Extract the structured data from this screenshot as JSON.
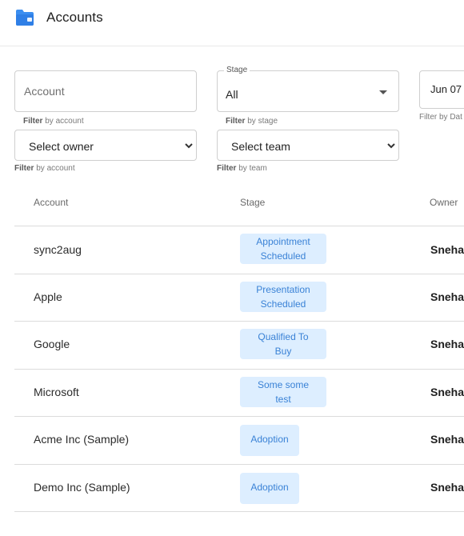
{
  "header": {
    "title": "Accounts",
    "icon": "folder-icon",
    "icon_color": "#3b8ef0"
  },
  "filters": {
    "account": {
      "placeholder": "Account",
      "hint_bold": "Filter",
      "hint_rest": " by account"
    },
    "stage": {
      "legend": "Stage",
      "value": "All",
      "hint_bold": "Filter",
      "hint_rest": " by stage"
    },
    "date": {
      "value": "Jun 07",
      "hint": "Filter by Dat"
    },
    "owner": {
      "value": "Select owner",
      "hint_bold": "Filter",
      "hint_rest": " by account"
    },
    "team": {
      "value": "Select team",
      "hint_bold": "Filter",
      "hint_rest": " by team"
    }
  },
  "table": {
    "columns": [
      "Account",
      "Stage",
      "Owner"
    ],
    "rows": [
      {
        "account": "sync2aug",
        "stage_line1": "Appointment",
        "stage_line2": "Scheduled",
        "owner": "Sneha"
      },
      {
        "account": "Apple",
        "stage_line1": "Presentation",
        "stage_line2": "Scheduled",
        "owner": "Sneha"
      },
      {
        "account": "Google",
        "stage_line1": "Qualified To",
        "stage_line2": "Buy",
        "owner": "Sneha"
      },
      {
        "account": "Microsoft",
        "stage_line1": "Some some",
        "stage_line2": "test",
        "owner": "Sneha"
      },
      {
        "account": "Acme Inc (Sample)",
        "stage_line1": "Adoption",
        "stage_line2": "",
        "owner": "Sneha"
      },
      {
        "account": "Demo Inc (Sample)",
        "stage_line1": "Adoption",
        "stage_line2": "",
        "owner": "Sneha"
      }
    ]
  },
  "colors": {
    "badge_bg": "#ddeeff",
    "badge_text": "#3a82d6"
  }
}
